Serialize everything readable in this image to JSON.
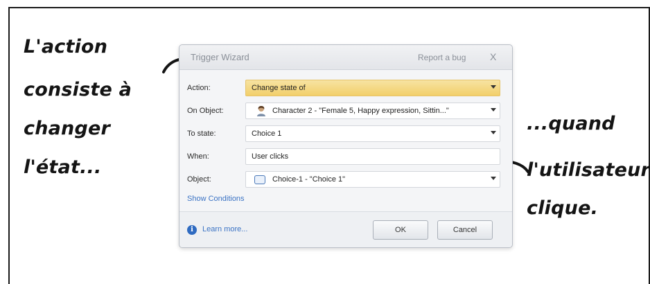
{
  "annotations": {
    "left_lines": [
      "L'action",
      "consiste à",
      "changer",
      "l'état..."
    ],
    "right_lines": [
      "...quand",
      "l'utilisateur",
      "clique."
    ]
  },
  "dialog": {
    "title": "Trigger Wizard",
    "report_bug": "Report a bug",
    "close_glyph": "X",
    "rows": [
      {
        "label": "Action:",
        "value": "Change state of",
        "icon": null
      },
      {
        "label": "On Object:",
        "value": "Character 2 - \"Female 5, Happy expression, Sittin...\"",
        "icon": "character-avatar-icon"
      },
      {
        "label": "To state:",
        "value": "Choice 1",
        "icon": null
      },
      {
        "label": "When:",
        "value": "User clicks",
        "icon": null
      },
      {
        "label": "Object:",
        "value": "Choice-1 - \"Choice 1\"",
        "icon": "choice-box-icon"
      }
    ],
    "show_conditions": "Show Conditions",
    "learn_more": "Learn more...",
    "ok_label": "OK",
    "cancel_label": "Cancel"
  },
  "colors": {
    "highlight": "#f2cf6a",
    "link": "#3b73c4",
    "info_icon": "#2f6bc1"
  }
}
